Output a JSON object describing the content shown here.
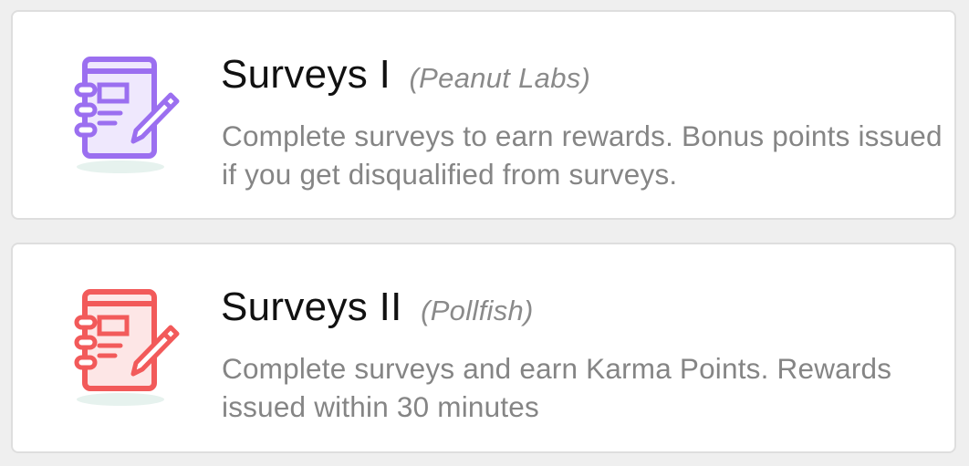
{
  "offers": [
    {
      "title": "Surveys I",
      "provider": "(Peanut Labs)",
      "description": "Complete surveys to earn rewards. Bonus points issued if you get disqualified from surveys.",
      "icon": "survey-notebook-icon",
      "accent_color": "#9b6ff0"
    },
    {
      "title": "Surveys II",
      "provider": "(Pollfish)",
      "description": "Complete surveys and earn Karma Points. Rewards issued within 30 minutes",
      "icon": "survey-notebook-icon",
      "accent_color": "#f25a5a"
    }
  ],
  "colors": {
    "background": "#efefef",
    "card": "#ffffff",
    "title": "#111111",
    "muted": "#858585"
  }
}
